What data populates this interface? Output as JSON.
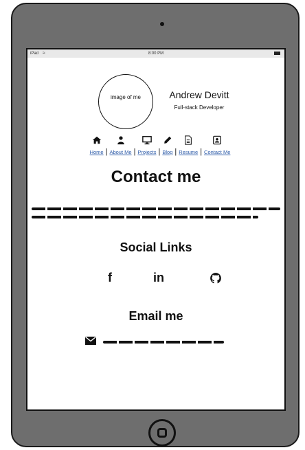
{
  "status_bar": {
    "carrier": "iPad",
    "time": "8:00 PM"
  },
  "profile": {
    "image_placeholder": "image of me",
    "name": "Andrew Devitt",
    "role": "Full-stack Developer"
  },
  "nav": {
    "items": [
      {
        "label": "Home",
        "icon": "home-icon"
      },
      {
        "label": "About Me",
        "icon": "user-icon"
      },
      {
        "label": "Projects",
        "icon": "monitor-icon"
      },
      {
        "label": "Blog",
        "icon": "pencil-icon"
      },
      {
        "label": "Resume",
        "icon": "document-icon"
      },
      {
        "label": "Contact Me",
        "icon": "contact-card-icon"
      }
    ]
  },
  "contact": {
    "title": "Contact me"
  },
  "social": {
    "title": "Social Links",
    "links": [
      {
        "label": "f",
        "icon": "facebook-icon"
      },
      {
        "label": "in",
        "icon": "linkedin-icon"
      },
      {
        "icon": "github-icon"
      }
    ]
  },
  "email": {
    "title": "Email me",
    "icon": "envelope-icon"
  }
}
